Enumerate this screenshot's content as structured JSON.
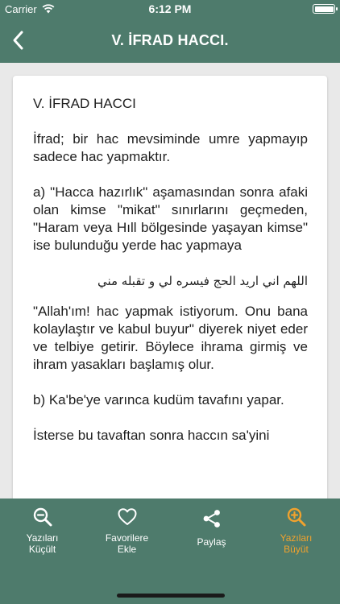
{
  "status_bar": {
    "carrier": "Carrier",
    "time": "6:12 PM"
  },
  "nav": {
    "title": "V. İFRAD HACCI.",
    "back_icon": "chevron-left-icon"
  },
  "content": {
    "heading": "V. İFRAD HACCI",
    "paragraphs": [
      "İfrad; bir hac mevsiminde umre yapmayıp sadece hac yapmaktır.",
      "a) \"Hacca hazırlık\" aşamasından sonra afaki olan kimse \"mikat\" sınırlarını geçmeden, \"Haram veya Hıll bölgesinde yaşayan kimse\" ise bulunduğu yerde hac yapmaya",
      "اللهم اني اريد الحج فيسره لي و تقبله مني",
      "\"Allah'ım! hac yapmak istiyorum. Onu bana kolaylaştır ve kabul buyur\" diyerek niyet eder ve telbiye getirir. Böylece ihrama girmiş ve ihram yasakları başlamış olur.",
      "b) Ka'be'ye varınca kudüm tavafını yapar.",
      "İsterse bu tavaftan sonra haccın sa'yini"
    ]
  },
  "tabs": [
    {
      "label": "Yazıları\nKüçült",
      "icon": "zoom-out-icon"
    },
    {
      "label": "Favorilere\nEkle",
      "icon": "heart-icon"
    },
    {
      "label": "Paylaş",
      "icon": "share-icon"
    },
    {
      "label": "Yazıları\nBüyüt",
      "icon": "zoom-in-icon"
    }
  ],
  "colors": {
    "primary": "#4e7b6c",
    "accent": "#f0a22e",
    "background": "#e9e9e9",
    "card": "#ffffff"
  }
}
